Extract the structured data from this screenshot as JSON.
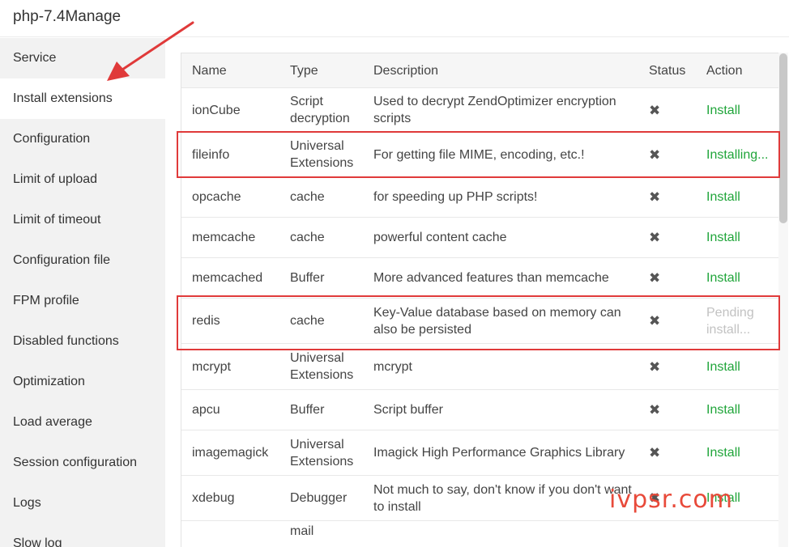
{
  "app": {
    "title": "php-7.4Manage"
  },
  "sidebar": {
    "items": [
      {
        "label": "Service"
      },
      {
        "label": "Install extensions"
      },
      {
        "label": "Configuration"
      },
      {
        "label": "Limit of upload"
      },
      {
        "label": "Limit of timeout"
      },
      {
        "label": "Configuration file"
      },
      {
        "label": "FPM profile"
      },
      {
        "label": "Disabled functions"
      },
      {
        "label": "Optimization"
      },
      {
        "label": "Load average"
      },
      {
        "label": "Session configuration"
      },
      {
        "label": "Logs"
      },
      {
        "label": "Slow log"
      }
    ],
    "active": "Install extensions"
  },
  "table": {
    "headers": {
      "name": "Name",
      "type": "Type",
      "description": "Description",
      "status": "Status",
      "action": "Action"
    },
    "status_icon": "close-icon",
    "rows": [
      {
        "name": "ionCube",
        "type": "Script decryption",
        "description": "Used to decrypt ZendOptimizer encryption scripts",
        "status": "✖",
        "action": "Install",
        "state": "install"
      },
      {
        "name": "fileinfo",
        "type": "Universal Extensions",
        "description": "For getting file MIME, encoding, etc.!",
        "status": "✖",
        "action": "Installing...",
        "state": "installing"
      },
      {
        "name": "opcache",
        "type": "cache",
        "description": "for speeding up PHP scripts!",
        "status": "✖",
        "action": "Install",
        "state": "install"
      },
      {
        "name": "memcache",
        "type": "cache",
        "description": "powerful content cache",
        "status": "✖",
        "action": "Install",
        "state": "install"
      },
      {
        "name": "memcached",
        "type": "Buffer",
        "description": "More advanced features than memcache",
        "status": "✖",
        "action": "Install",
        "state": "install"
      },
      {
        "name": "redis",
        "type": "cache",
        "description": "Key-Value database based on memory can also be persisted",
        "status": "✖",
        "action": "Pending install...",
        "state": "pending"
      },
      {
        "name": "mcrypt",
        "type": "Universal Extensions",
        "description": "mcrypt",
        "status": "✖",
        "action": "Install",
        "state": "install"
      },
      {
        "name": "apcu",
        "type": "Buffer",
        "description": "Script buffer",
        "status": "✖",
        "action": "Install",
        "state": "install"
      },
      {
        "name": "imagemagick",
        "type": "Universal Extensions",
        "description": "Imagick High Performance Graphics Library",
        "status": "✖",
        "action": "Install",
        "state": "install"
      },
      {
        "name": "xdebug",
        "type": "Debugger",
        "description": "Not much to say, don't know if you don't want to install",
        "status": "✖",
        "action": "Install",
        "state": "install"
      },
      {
        "name": "",
        "type": "mail",
        "description": "",
        "status": "",
        "action": "",
        "state": "partial"
      }
    ]
  },
  "colors": {
    "accent_green": "#20a53a",
    "highlight_red": "#e03a3a",
    "pending_gray": "#c2c2c2",
    "sidebar_bg": "#f2f2f2"
  },
  "watermark": "ivpsr.com"
}
